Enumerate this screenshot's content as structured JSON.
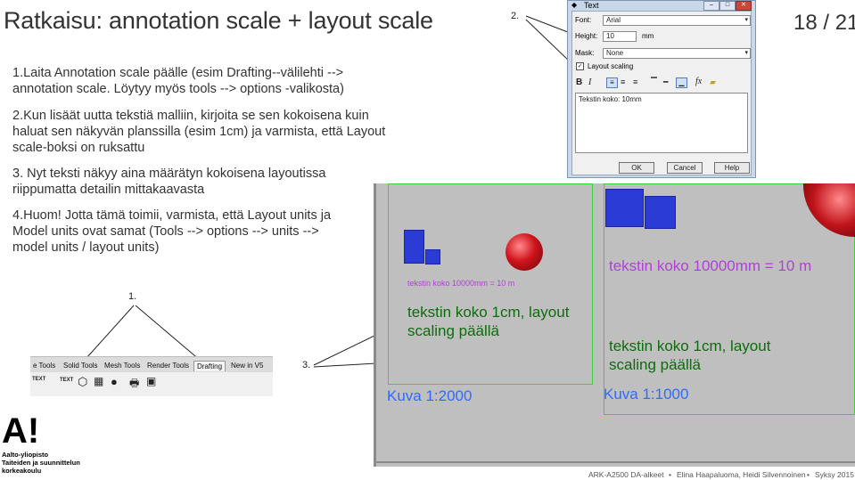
{
  "slide": {
    "title": "Ratkaisu: annotation scale + layout scale",
    "page_number": "18 / 21",
    "points": [
      "1.Laita Annotation scale päälle (esim Drafting--välilehti --> annotation scale. Löytyy myös tools --> options -valikosta)",
      "2.Kun lisäät uutta tekstiä malliin, kirjoita se sen kokoisena kuin haluat sen näkyvän planssilla (esim 1cm) ja varmista, että Layout scale-boksi on ruksattu",
      "3. Nyt teksti näkyy aina määrätyn kokoisena layoutissa riippumatta detailin mittakaavasta",
      "4.Huom! Jotta tämä toimii, varmista, että Layout units ja Model units ovat samat (Tools --> options --> units --> model units / layout units)"
    ],
    "callouts": {
      "one": "1.",
      "two": "2.",
      "three": "3."
    }
  },
  "text_dialog": {
    "title": "Text",
    "font_label": "Font:",
    "font_value": "Arial",
    "height_label": "Height:",
    "height_value": "10",
    "height_unit": "mm",
    "mask_label": "Mask:",
    "mask_value": "None",
    "layout_scaling_label": "Layout scaling",
    "text_content": "Tekstin koko: 10mm",
    "ok_label": "OK",
    "cancel_label": "Cancel",
    "help_label": "Help",
    "bold_glyph": "B",
    "italic_glyph": "I",
    "fx_glyph": "fx"
  },
  "toolbar_tabs": {
    "tabs": [
      "e Tools",
      "Solid Tools",
      "Mesh Tools",
      "Render Tools",
      "Drafting",
      "New in V5"
    ],
    "active_tab": "Drafting",
    "icon_text_1": "TEXT",
    "icon_text_2": "TEXT"
  },
  "viewport": {
    "left_small_text": "tekstin koko 10000mm = 10 m",
    "left_green_text_line1": "tekstin koko 1cm, layout",
    "left_green_text_line2": "scaling päällä",
    "left_scale": "Kuva 1:2000",
    "right_purple_text": "tekstin koko 10000mm = 10 m",
    "right_green_text_line1": "tekstin koko 1cm, layout",
    "right_green_text_line2": "scaling päällä",
    "right_scale": "Kuva 1:1000"
  },
  "footer": {
    "course": "ARK-A2500 DA-alkeet",
    "authors": "Elina Haapaluoma, Heidi Silvennoinen",
    "term": "Syksy 2015",
    "bullet": "•"
  },
  "logo": {
    "mark": "A!",
    "line1": "Aalto-yliopisto",
    "line2": "Taiteiden ja suunnittelun",
    "line3": "korkeakoulu"
  },
  "colors": {
    "viewport_bg": "#bfbfbf",
    "frame_green": "#3fcf3f",
    "text_green": "#0e6b0e",
    "text_purple": "#b040d8",
    "scale_blue": "#2f6bff",
    "block_blue": "#2a3bd6",
    "sphere_red": "#c0141b"
  }
}
